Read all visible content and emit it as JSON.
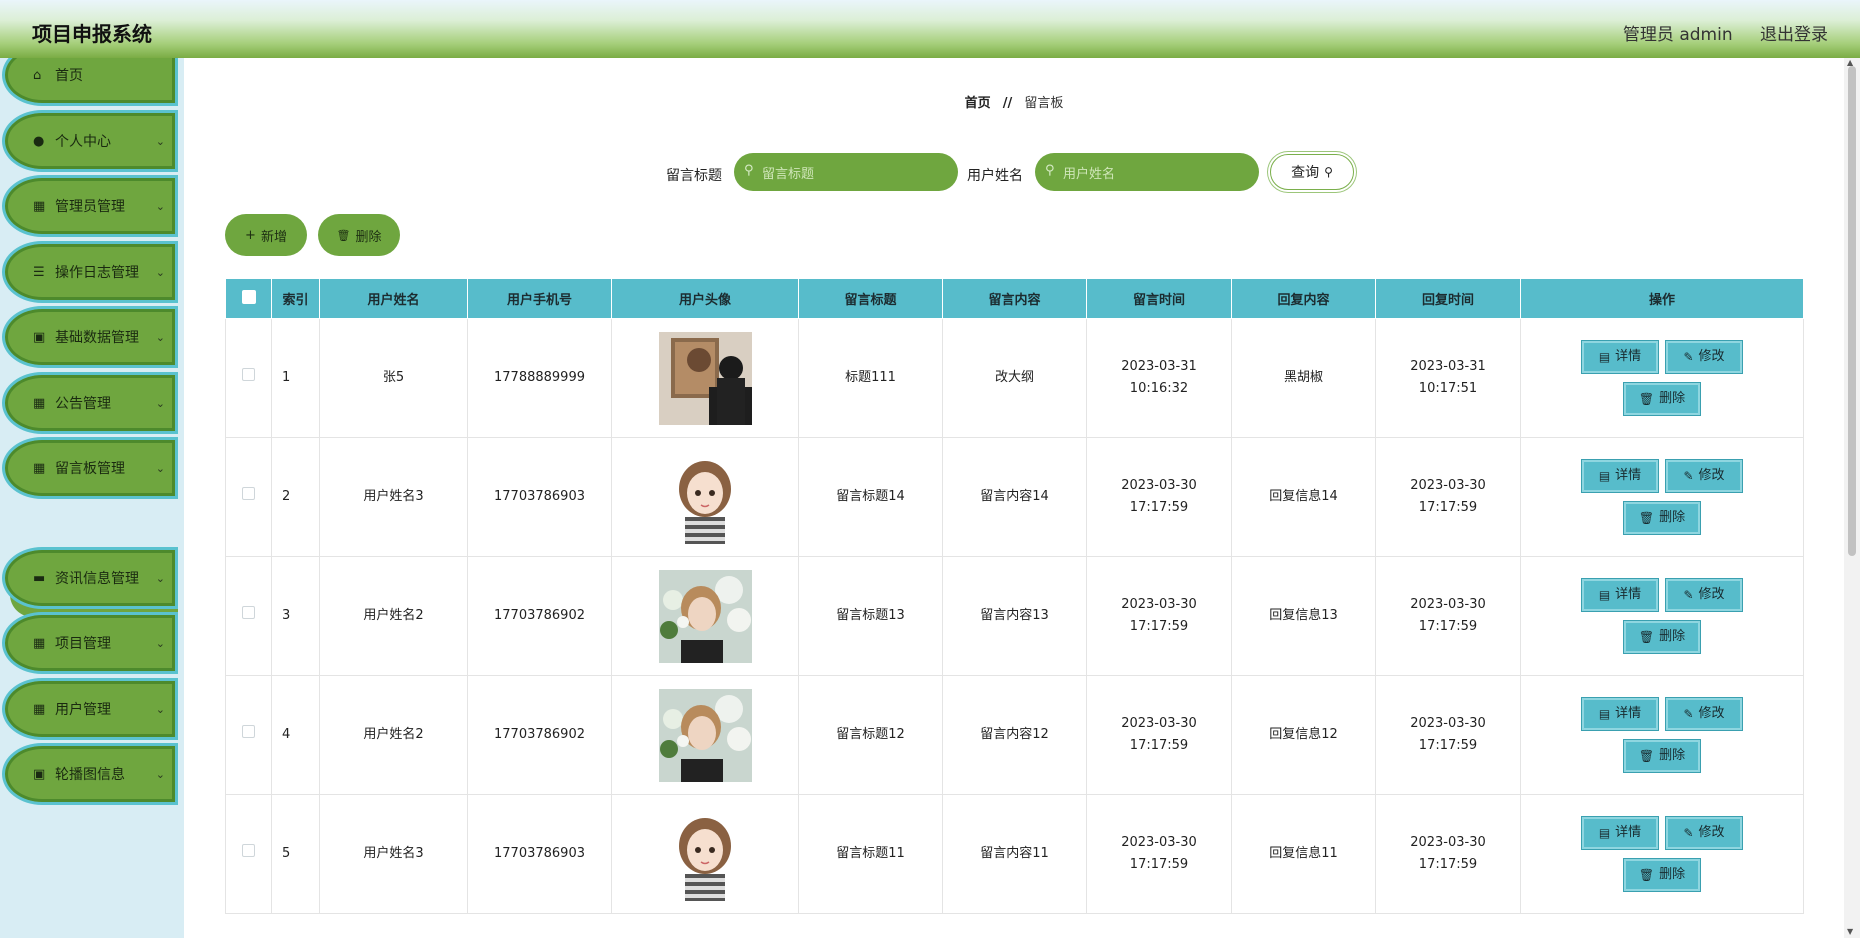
{
  "header": {
    "title": "项目申报系统",
    "user_label": "管理员 admin",
    "logout_label": "退出登录"
  },
  "sidebar": {
    "items": [
      {
        "label": "首页",
        "icon": "home-icon"
      },
      {
        "label": "个人中心",
        "icon": "user-icon"
      },
      {
        "label": "管理员管理",
        "icon": "grid-icon"
      },
      {
        "label": "操作日志管理",
        "icon": "sliders-icon"
      },
      {
        "label": "基础数据管理",
        "icon": "clipboard-icon"
      },
      {
        "label": "公告管理",
        "icon": "grid-icon"
      },
      {
        "label": "留言板管理",
        "icon": "grid-icon"
      },
      {
        "label": "资讯信息管理",
        "icon": "ticket-icon"
      },
      {
        "label": "项目管理",
        "icon": "grid-icon"
      },
      {
        "label": "用户管理",
        "icon": "grid-icon"
      },
      {
        "label": "轮播图信息",
        "icon": "image-icon"
      }
    ],
    "active_submenu": "留言板管理"
  },
  "breadcrumb": {
    "home": "首页",
    "separator": "//",
    "current": "留言板"
  },
  "search": {
    "title_label": "留言标题",
    "title_placeholder": "留言标题",
    "name_label": "用户姓名",
    "name_placeholder": "用户姓名",
    "query_label": "查询"
  },
  "actions": {
    "add_label": "新增",
    "delete_label": "删除"
  },
  "table": {
    "columns": [
      "索引",
      "用户姓名",
      "用户手机号",
      "用户头像",
      "留言标题",
      "留言内容",
      "留言时间",
      "回复内容",
      "回复时间",
      "操作"
    ],
    "row_buttons": {
      "detail": "详情",
      "edit": "修改",
      "delete": "删除"
    },
    "rows": [
      {
        "index": "1",
        "name": "张5",
        "phone": "17788889999",
        "avatar": "photo-woman-painting",
        "title": "标题111",
        "content": "改大纲",
        "time": "2023-03-31 10:16:32",
        "reply": "黑胡椒",
        "reply_time": "2023-03-31 10:17:51"
      },
      {
        "index": "2",
        "name": "用户姓名3",
        "phone": "17703786903",
        "avatar": "cartoon-girl",
        "title": "留言标题14",
        "content": "留言内容14",
        "time": "2023-03-30 17:17:59",
        "reply": "回复信息14",
        "reply_time": "2023-03-30 17:17:59"
      },
      {
        "index": "3",
        "name": "用户姓名2",
        "phone": "17703786902",
        "avatar": "photo-flowers",
        "title": "留言标题13",
        "content": "留言内容13",
        "time": "2023-03-30 17:17:59",
        "reply": "回复信息13",
        "reply_time": "2023-03-30 17:17:59"
      },
      {
        "index": "4",
        "name": "用户姓名2",
        "phone": "17703786902",
        "avatar": "photo-flowers",
        "title": "留言标题12",
        "content": "留言内容12",
        "time": "2023-03-30 17:17:59",
        "reply": "回复信息12",
        "reply_time": "2023-03-30 17:17:59"
      },
      {
        "index": "5",
        "name": "用户姓名3",
        "phone": "17703786903",
        "avatar": "cartoon-girl",
        "title": "留言标题11",
        "content": "留言内容11",
        "time": "2023-03-30 17:17:59",
        "reply": "回复信息11",
        "reply_time": "2023-03-30 17:17:59"
      }
    ]
  },
  "colors": {
    "green": "#6fa63f",
    "teal": "#57bccb",
    "sidebar_bg": "#d8edf4"
  }
}
